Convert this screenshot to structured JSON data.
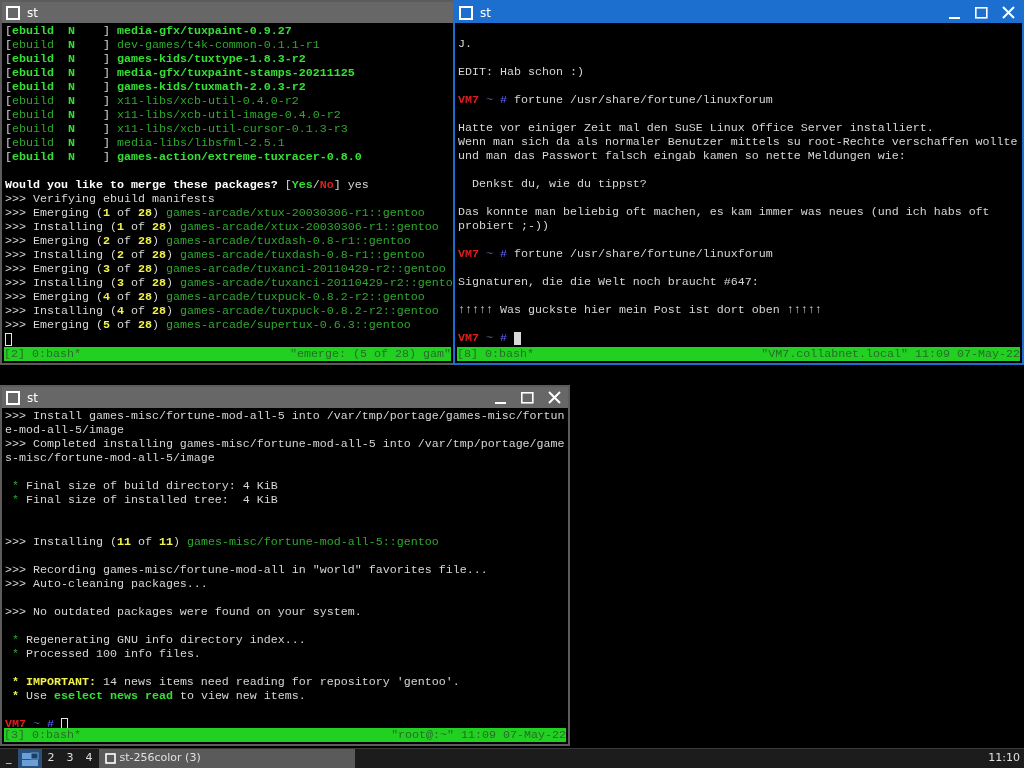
{
  "windows": [
    {
      "title": "st",
      "active": false,
      "has_controls": false,
      "lines": [
        {
          "kind": "text",
          "segments": [
            {
              "text": "[",
              "kind": "plain"
            },
            {
              "text": "ebuild  N    ",
              "kind": "green"
            },
            {
              "text": "] ",
              "kind": "plain"
            },
            {
              "text": "media-gfx/tuxpaint-0.9.27",
              "kind": "green"
            }
          ]
        },
        {
          "kind": "text",
          "segments": [
            {
              "text": "[",
              "kind": "plain"
            },
            {
              "text": "ebuild  ",
              "kind": "dim"
            },
            {
              "text": "N    ",
              "kind": "green"
            },
            {
              "text": "] ",
              "kind": "plain"
            },
            {
              "text": "dev-games/t4k-common-0.1.1-r1",
              "kind": "dim"
            }
          ]
        },
        {
          "kind": "text",
          "segments": [
            {
              "text": "[",
              "kind": "plain"
            },
            {
              "text": "ebuild  N    ",
              "kind": "green"
            },
            {
              "text": "] ",
              "kind": "plain"
            },
            {
              "text": "games-kids/tuxtype-1.8.3-r2",
              "kind": "green"
            }
          ]
        },
        {
          "kind": "text",
          "segments": [
            {
              "text": "[",
              "kind": "plain"
            },
            {
              "text": "ebuild  N    ",
              "kind": "green"
            },
            {
              "text": "] ",
              "kind": "plain"
            },
            {
              "text": "media-gfx/tuxpaint-stamps-20211125",
              "kind": "green"
            }
          ]
        },
        {
          "kind": "text",
          "segments": [
            {
              "text": "[",
              "kind": "plain"
            },
            {
              "text": "ebuild  N    ",
              "kind": "green"
            },
            {
              "text": "] ",
              "kind": "plain"
            },
            {
              "text": "games-kids/tuxmath-2.0.3-r2",
              "kind": "green"
            }
          ]
        },
        {
          "kind": "text",
          "segments": [
            {
              "text": "[",
              "kind": "plain"
            },
            {
              "text": "ebuild  ",
              "kind": "dim"
            },
            {
              "text": "N    ",
              "kind": "green"
            },
            {
              "text": "] ",
              "kind": "plain"
            },
            {
              "text": "x11-libs/xcb-util-0.4.0-r2",
              "kind": "dim"
            }
          ]
        },
        {
          "kind": "text",
          "segments": [
            {
              "text": "[",
              "kind": "plain"
            },
            {
              "text": "ebuild  ",
              "kind": "dim"
            },
            {
              "text": "N    ",
              "kind": "green"
            },
            {
              "text": "] ",
              "kind": "plain"
            },
            {
              "text": "x11-libs/xcb-util-image-0.4.0-r2",
              "kind": "dim"
            }
          ]
        },
        {
          "kind": "text",
          "segments": [
            {
              "text": "[",
              "kind": "plain"
            },
            {
              "text": "ebuild  ",
              "kind": "dim"
            },
            {
              "text": "N    ",
              "kind": "green"
            },
            {
              "text": "] ",
              "kind": "plain"
            },
            {
              "text": "x11-libs/xcb-util-cursor-0.1.3-r3",
              "kind": "dim"
            }
          ]
        },
        {
          "kind": "text",
          "segments": [
            {
              "text": "[",
              "kind": "plain"
            },
            {
              "text": "ebuild  ",
              "kind": "dim"
            },
            {
              "text": "N    ",
              "kind": "green"
            },
            {
              "text": "] ",
              "kind": "plain"
            },
            {
              "text": "media-libs/libsfml-2.5.1",
              "kind": "dim"
            }
          ]
        },
        {
          "kind": "text",
          "segments": [
            {
              "text": "[",
              "kind": "plain"
            },
            {
              "text": "ebuild  N    ",
              "kind": "green"
            },
            {
              "text": "] ",
              "kind": "plain"
            },
            {
              "text": "games-action/extreme-tuxracer-0.8.0",
              "kind": "green"
            }
          ]
        },
        {
          "kind": "blank"
        },
        {
          "kind": "text",
          "segments": [
            {
              "text": "Would you like to merge these packages?",
              "kind": "bold"
            },
            {
              "text": " [",
              "kind": "plain"
            },
            {
              "text": "Yes",
              "kind": "green"
            },
            {
              "text": "/",
              "kind": "plain"
            },
            {
              "text": "No",
              "kind": "red"
            },
            {
              "text": "] yes",
              "kind": "plain"
            }
          ]
        },
        {
          "kind": "text",
          "segments": [
            {
              "text": ">>> Verifying ebuild manifests",
              "kind": "plain"
            }
          ]
        },
        {
          "kind": "text",
          "segments": [
            {
              "text": ">>> Emerging (",
              "kind": "plain"
            },
            {
              "text": "1",
              "kind": "yellow"
            },
            {
              "text": " of ",
              "kind": "plain"
            },
            {
              "text": "28",
              "kind": "yellow"
            },
            {
              "text": ") ",
              "kind": "plain"
            },
            {
              "text": "games-arcade/xtux-20030306-r1::gentoo",
              "kind": "dim"
            }
          ]
        },
        {
          "kind": "text",
          "segments": [
            {
              "text": ">>> Installing (",
              "kind": "plain"
            },
            {
              "text": "1",
              "kind": "yellow"
            },
            {
              "text": " of ",
              "kind": "plain"
            },
            {
              "text": "28",
              "kind": "yellow"
            },
            {
              "text": ") ",
              "kind": "plain"
            },
            {
              "text": "games-arcade/xtux-20030306-r1::gentoo",
              "kind": "dim"
            }
          ]
        },
        {
          "kind": "text",
          "segments": [
            {
              "text": ">>> Emerging (",
              "kind": "plain"
            },
            {
              "text": "2",
              "kind": "yellow"
            },
            {
              "text": " of ",
              "kind": "plain"
            },
            {
              "text": "28",
              "kind": "yellow"
            },
            {
              "text": ") ",
              "kind": "plain"
            },
            {
              "text": "games-arcade/tuxdash-0.8-r1::gentoo",
              "kind": "dim"
            }
          ]
        },
        {
          "kind": "text",
          "segments": [
            {
              "text": ">>> Installing (",
              "kind": "plain"
            },
            {
              "text": "2",
              "kind": "yellow"
            },
            {
              "text": " of ",
              "kind": "plain"
            },
            {
              "text": "28",
              "kind": "yellow"
            },
            {
              "text": ") ",
              "kind": "plain"
            },
            {
              "text": "games-arcade/tuxdash-0.8-r1::gentoo",
              "kind": "dim"
            }
          ]
        },
        {
          "kind": "text",
          "segments": [
            {
              "text": ">>> Emerging (",
              "kind": "plain"
            },
            {
              "text": "3",
              "kind": "yellow"
            },
            {
              "text": " of ",
              "kind": "plain"
            },
            {
              "text": "28",
              "kind": "yellow"
            },
            {
              "text": ") ",
              "kind": "plain"
            },
            {
              "text": "games-arcade/tuxanci-20110429-r2::gentoo",
              "kind": "dim"
            }
          ]
        },
        {
          "kind": "text",
          "segments": [
            {
              "text": ">>> Installing (",
              "kind": "plain"
            },
            {
              "text": "3",
              "kind": "yellow"
            },
            {
              "text": " of ",
              "kind": "plain"
            },
            {
              "text": "28",
              "kind": "yellow"
            },
            {
              "text": ") ",
              "kind": "plain"
            },
            {
              "text": "games-arcade/tuxanci-20110429-r2::gento",
              "kind": "dim"
            }
          ]
        },
        {
          "kind": "text",
          "segments": [
            {
              "text": ">>> Emerging (",
              "kind": "plain"
            },
            {
              "text": "4",
              "kind": "yellow"
            },
            {
              "text": " of ",
              "kind": "plain"
            },
            {
              "text": "28",
              "kind": "yellow"
            },
            {
              "text": ") ",
              "kind": "plain"
            },
            {
              "text": "games-arcade/tuxpuck-0.8.2-r2::gentoo",
              "kind": "dim"
            }
          ]
        },
        {
          "kind": "text",
          "segments": [
            {
              "text": ">>> Installing (",
              "kind": "plain"
            },
            {
              "text": "4",
              "kind": "yellow"
            },
            {
              "text": " of ",
              "kind": "plain"
            },
            {
              "text": "28",
              "kind": "yellow"
            },
            {
              "text": ") ",
              "kind": "plain"
            },
            {
              "text": "games-arcade/tuxpuck-0.8.2-r2::gentoo",
              "kind": "dim"
            }
          ]
        },
        {
          "kind": "text",
          "segments": [
            {
              "text": ">>> Emerging (",
              "kind": "plain"
            },
            {
              "text": "5",
              "kind": "yellow"
            },
            {
              "text": " of ",
              "kind": "plain"
            },
            {
              "text": "28",
              "kind": "yellow"
            },
            {
              "text": ") ",
              "kind": "plain"
            },
            {
              "text": "games-arcade/supertux-0.6.3::gentoo",
              "kind": "dim"
            }
          ]
        },
        {
          "kind": "text",
          "segments": [
            {
              "kind": "hollow_cursor"
            }
          ]
        }
      ],
      "status_bar": {
        "left": "[2] 0:bash*",
        "right": "\"emerge: (5 of 28) gam\""
      }
    },
    {
      "title": "st",
      "active": true,
      "has_controls": true,
      "lines": [
        {
          "kind": "blank"
        },
        {
          "kind": "text",
          "segments": [
            {
              "text": "J.",
              "kind": "plain"
            }
          ]
        },
        {
          "kind": "blank"
        },
        {
          "kind": "text",
          "segments": [
            {
              "text": "EDIT: Hab schon :)",
              "kind": "plain"
            }
          ]
        },
        {
          "kind": "blank"
        },
        {
          "kind": "text",
          "segments": [
            {
              "text": "VM7",
              "kind": "red"
            },
            {
              "text": " ~ ",
              "kind": "tilde"
            },
            {
              "text": "#",
              "kind": "blue"
            },
            {
              "text": " fortune /usr/share/fortune/linuxforum",
              "kind": "plain"
            }
          ]
        },
        {
          "kind": "blank"
        },
        {
          "kind": "text",
          "segments": [
            {
              "text": "Hatte vor einiger Zeit mal den SuSE Linux Office Server installiert.",
              "kind": "plain"
            }
          ]
        },
        {
          "kind": "text",
          "segments": [
            {
              "text": "Wenn man sich da als normaler Benutzer mittels su root-Rechte verschaffen wollte",
              "kind": "plain"
            }
          ]
        },
        {
          "kind": "text",
          "segments": [
            {
              "text": "und man das Passwort falsch eingab kamen so nette Meldungen wie:",
              "kind": "plain"
            }
          ]
        },
        {
          "kind": "blank"
        },
        {
          "kind": "text",
          "segments": [
            {
              "text": "  Denkst du, wie du tippst?",
              "kind": "plain"
            }
          ]
        },
        {
          "kind": "blank"
        },
        {
          "kind": "text",
          "segments": [
            {
              "text": "Das konnte man beliebig oft machen, es kam immer was neues (und ich habs oft",
              "kind": "plain"
            }
          ]
        },
        {
          "kind": "text",
          "segments": [
            {
              "text": "probiert ;-))",
              "kind": "plain"
            }
          ]
        },
        {
          "kind": "blank"
        },
        {
          "kind": "text",
          "segments": [
            {
              "text": "VM7",
              "kind": "red"
            },
            {
              "text": " ~ ",
              "kind": "tilde"
            },
            {
              "text": "#",
              "kind": "blue"
            },
            {
              "text": " fortune /usr/share/fortune/linuxforum",
              "kind": "plain"
            }
          ]
        },
        {
          "kind": "blank"
        },
        {
          "kind": "text",
          "segments": [
            {
              "text": "Signaturen, die die Welt noch braucht #647:",
              "kind": "plain"
            }
          ]
        },
        {
          "kind": "blank"
        },
        {
          "kind": "text",
          "segments": [
            {
              "text": "↑↑↑↑↑ Was guckste hier mein Post ist dort oben ↑↑↑↑↑",
              "kind": "plain"
            }
          ]
        },
        {
          "kind": "blank"
        },
        {
          "kind": "text",
          "segments": [
            {
              "text": "VM7",
              "kind": "red"
            },
            {
              "text": " ~ ",
              "kind": "tilde"
            },
            {
              "text": "# ",
              "kind": "blue"
            },
            {
              "kind": "block_cursor"
            }
          ]
        }
      ],
      "status_bar": {
        "left": "[8] 0:bash*",
        "right": "\"VM7.collabnet.local\" 11:09 07-May-22"
      }
    },
    {
      "title": "st",
      "active": false,
      "has_controls": true,
      "lines": [
        {
          "kind": "text",
          "segments": [
            {
              "text": ">>> Install games-misc/fortune-mod-all-5 into /var/tmp/portage/games-misc/fortun",
              "kind": "plain"
            }
          ]
        },
        {
          "kind": "text",
          "segments": [
            {
              "text": "e-mod-all-5/image",
              "kind": "plain"
            }
          ]
        },
        {
          "kind": "text",
          "segments": [
            {
              "text": ">>> Completed installing games-misc/fortune-mod-all-5 into /var/tmp/portage/game",
              "kind": "plain"
            }
          ]
        },
        {
          "kind": "text",
          "segments": [
            {
              "text": "s-misc/fortune-mod-all-5/image",
              "kind": "plain"
            }
          ]
        },
        {
          "kind": "blank"
        },
        {
          "kind": "text",
          "segments": [
            {
              "text": " *",
              "kind": "dim"
            },
            {
              "text": " Final size of build directory: 4 KiB",
              "kind": "plain"
            }
          ]
        },
        {
          "kind": "text",
          "segments": [
            {
              "text": " *",
              "kind": "dim"
            },
            {
              "text": " Final size of installed tree:  4 KiB",
              "kind": "plain"
            }
          ]
        },
        {
          "kind": "blank"
        },
        {
          "kind": "blank"
        },
        {
          "kind": "text",
          "segments": [
            {
              "text": ">>> Installing (",
              "kind": "plain"
            },
            {
              "text": "11",
              "kind": "yellow"
            },
            {
              "text": " of ",
              "kind": "plain"
            },
            {
              "text": "11",
              "kind": "yellow"
            },
            {
              "text": ") ",
              "kind": "plain"
            },
            {
              "text": "games-misc/fortune-mod-all-5::gentoo",
              "kind": "dim"
            }
          ]
        },
        {
          "kind": "blank"
        },
        {
          "kind": "text",
          "segments": [
            {
              "text": ">>> Recording games-misc/fortune-mod-all in \"world\" favorites file...",
              "kind": "plain"
            }
          ]
        },
        {
          "kind": "text",
          "segments": [
            {
              "text": ">>> Auto-cleaning packages...",
              "kind": "plain"
            }
          ]
        },
        {
          "kind": "blank"
        },
        {
          "kind": "text",
          "segments": [
            {
              "text": ">>> No outdated packages were found on your system.",
              "kind": "plain"
            }
          ]
        },
        {
          "kind": "blank"
        },
        {
          "kind": "text",
          "segments": [
            {
              "text": " *",
              "kind": "dim"
            },
            {
              "text": " Regenerating GNU info directory index...",
              "kind": "plain"
            }
          ]
        },
        {
          "kind": "text",
          "segments": [
            {
              "text": " *",
              "kind": "dim"
            },
            {
              "text": " Processed 100 info files.",
              "kind": "plain"
            }
          ]
        },
        {
          "kind": "blank"
        },
        {
          "kind": "text",
          "segments": [
            {
              "text": " * IMPORTANT:",
              "kind": "yellow"
            },
            {
              "text": " 14 news items need reading for repository 'gentoo'.",
              "kind": "plain"
            }
          ]
        },
        {
          "kind": "text",
          "segments": [
            {
              "text": " *",
              "kind": "yellow"
            },
            {
              "text": " Use ",
              "kind": "plain"
            },
            {
              "text": "eselect news read",
              "kind": "green"
            },
            {
              "text": " to view new items.",
              "kind": "plain"
            }
          ]
        },
        {
          "kind": "blank"
        },
        {
          "kind": "text",
          "segments": [
            {
              "text": "VM7",
              "kind": "red"
            },
            {
              "text": " ~ ",
              "kind": "tilde"
            },
            {
              "text": "# ",
              "kind": "blue"
            },
            {
              "kind": "hollow_cursor"
            }
          ]
        }
      ],
      "status_bar": {
        "left": "[3] 0:bash*",
        "right": "\"root@:~\" 11:09 07-May-22"
      }
    }
  ],
  "taskbar": {
    "show_desktop": "_",
    "desktops": [
      {
        "selected": true
      },
      {
        "label": "2",
        "selected": false
      },
      {
        "label": "3",
        "selected": false
      },
      {
        "label": "4",
        "selected": false
      }
    ],
    "tasks": [
      {
        "label": "st-256color (3)",
        "selected": true
      }
    ],
    "clock": "11:10"
  }
}
